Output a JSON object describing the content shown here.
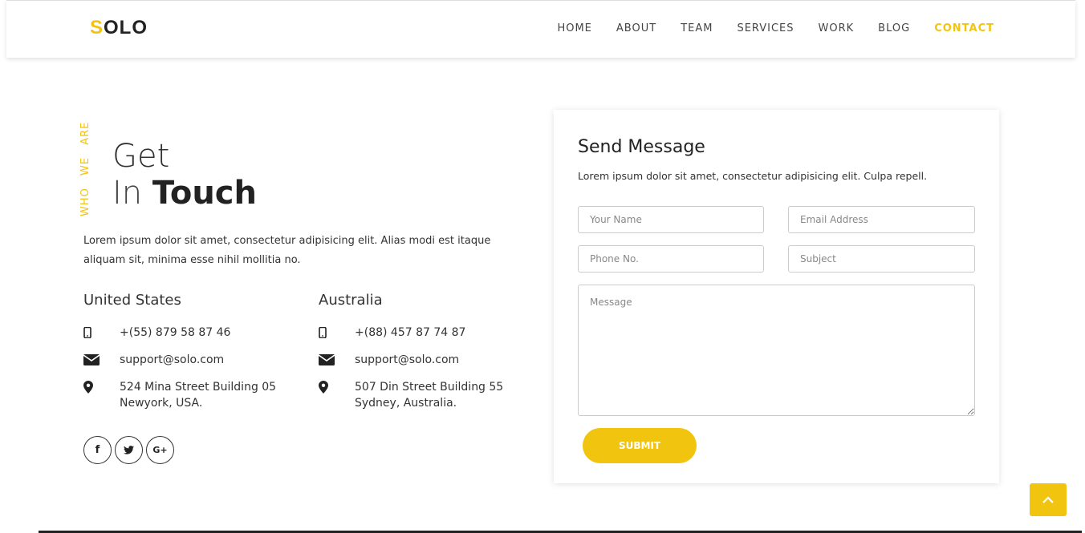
{
  "logo": {
    "first": "S",
    "rest": "OLO"
  },
  "nav": {
    "items": [
      {
        "label": "HOME"
      },
      {
        "label": "ABOUT"
      },
      {
        "label": "TEAM"
      },
      {
        "label": "SERVICES"
      },
      {
        "label": "WORK"
      },
      {
        "label": "BLOG"
      },
      {
        "label": "CONTACT",
        "active": true
      }
    ]
  },
  "hero": {
    "tag": "WHO WE ARE",
    "line1": "Get",
    "line2_light": "In",
    "line2_bold": "Touch",
    "intro": "Lorem ipsum dolor sit amet, consectetur adipisicing elit. Alias modi est itaque aliquam sit, minima esse nihil mollitia no."
  },
  "offices": [
    {
      "name": "United States",
      "phone": "+(55) 879 58 87 46",
      "email": "support@solo.com",
      "address_line1": "524 Mina Street Building 05",
      "address_line2": "Newyork, USA."
    },
    {
      "name": "Australia",
      "phone": "+(88) 457 87 74 87",
      "email": "support@solo.com",
      "address_line1": "507 Din Street Building 55",
      "address_line2": "Sydney, Australia."
    }
  ],
  "social": {
    "facebook": "f",
    "googleplus": "G+"
  },
  "form": {
    "title": "Send Message",
    "subtitle": "Lorem ipsum dolor sit amet, consectetur adipisicing elit. Culpa repell.",
    "name_placeholder": "Your Name",
    "email_placeholder": "Email Address",
    "phone_placeholder": "Phone No.",
    "subject_placeholder": "Subject",
    "message_placeholder": "Message",
    "submit_label": "SUBMIT"
  },
  "colors": {
    "accent": "#f1c40f",
    "text": "#333333"
  }
}
